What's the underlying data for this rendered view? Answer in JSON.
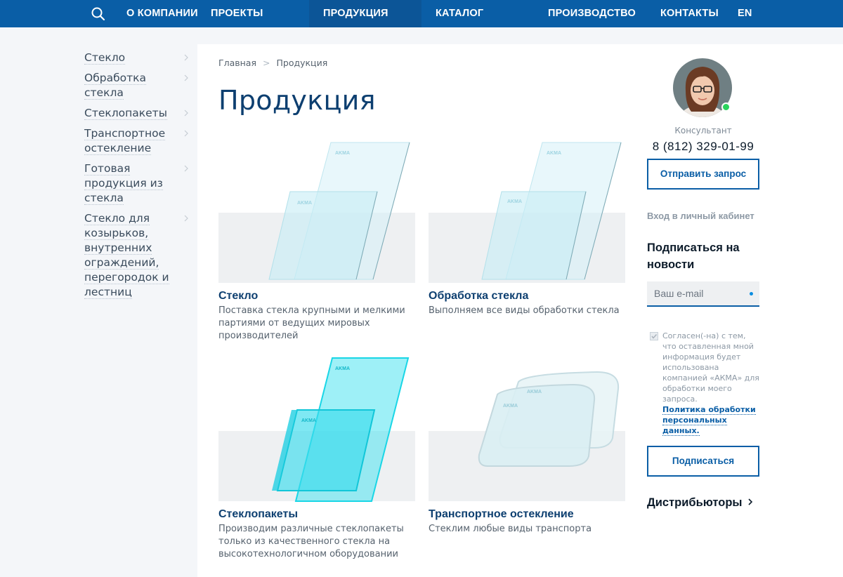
{
  "nav": {
    "search_icon": "search-icon",
    "items": [
      {
        "label": "О КОМПАНИИ"
      },
      {
        "label": "ПРОЕКТЫ"
      },
      {
        "label": "ПРОДУКЦИЯ"
      },
      {
        "label": "КАТАЛОГ"
      },
      {
        "label": "ПРОИЗВОДСТВО"
      },
      {
        "label": "КОНТАКТЫ"
      },
      {
        "label": "EN"
      }
    ],
    "active": "ПРОДУКЦИЯ"
  },
  "sidebar": {
    "items": [
      {
        "label": "Стекло"
      },
      {
        "label": "Обработка стекла"
      },
      {
        "label": "Стеклопакеты"
      },
      {
        "label": "Транспортное остекление"
      },
      {
        "label": "Готовая продукция из стекла"
      },
      {
        "label": "Стекло для козырьков, внутренних ограждений, перегородок и лестниц"
      }
    ]
  },
  "breadcrumb": {
    "home": "Главная",
    "current": "Продукция"
  },
  "page": {
    "title": "Продукция"
  },
  "products": [
    {
      "title": "Стекло",
      "desc": "Поставка стекла крупными и мелкими партиями от ведущих мировых производителей",
      "brand": "AKMA"
    },
    {
      "title": "Обработка стекла",
      "desc": "Выполняем все виды обработки стекла",
      "brand": "AKMA"
    },
    {
      "title": "Стеклопакеты",
      "desc": "Производим различные стеклопакеты только из качественного стекла на высокотехнологичном оборудовании",
      "brand": "AKMA"
    },
    {
      "title": "Транспортное остекление",
      "desc": "Стеклим любые виды транспорта",
      "brand": "AKMA"
    }
  ],
  "consultant": {
    "label": "Консультант",
    "phone": "8 (812) 329-01-99",
    "request_button": "Отправить запрос",
    "status_color": "#2ad35c"
  },
  "account": {
    "login_link": "Вход в личный кабинет"
  },
  "subscribe": {
    "heading": "Подписаться на новости",
    "email_placeholder": "Ваш e-mail",
    "email_value": "",
    "consent_text": "Согласен(-на) с тем, что оставленная мной информация будет использована компанией «АКМА» для обработки моего запроса.",
    "consent_checked": true,
    "policy_link": "Политика обработки персональных данных.",
    "button": "Подписаться"
  },
  "distributors": {
    "label": "Дистрибьюторы"
  },
  "colors": {
    "brand": "#0a5ea6",
    "title": "#0d3f70",
    "glass_cyan": "#19d6e6"
  }
}
